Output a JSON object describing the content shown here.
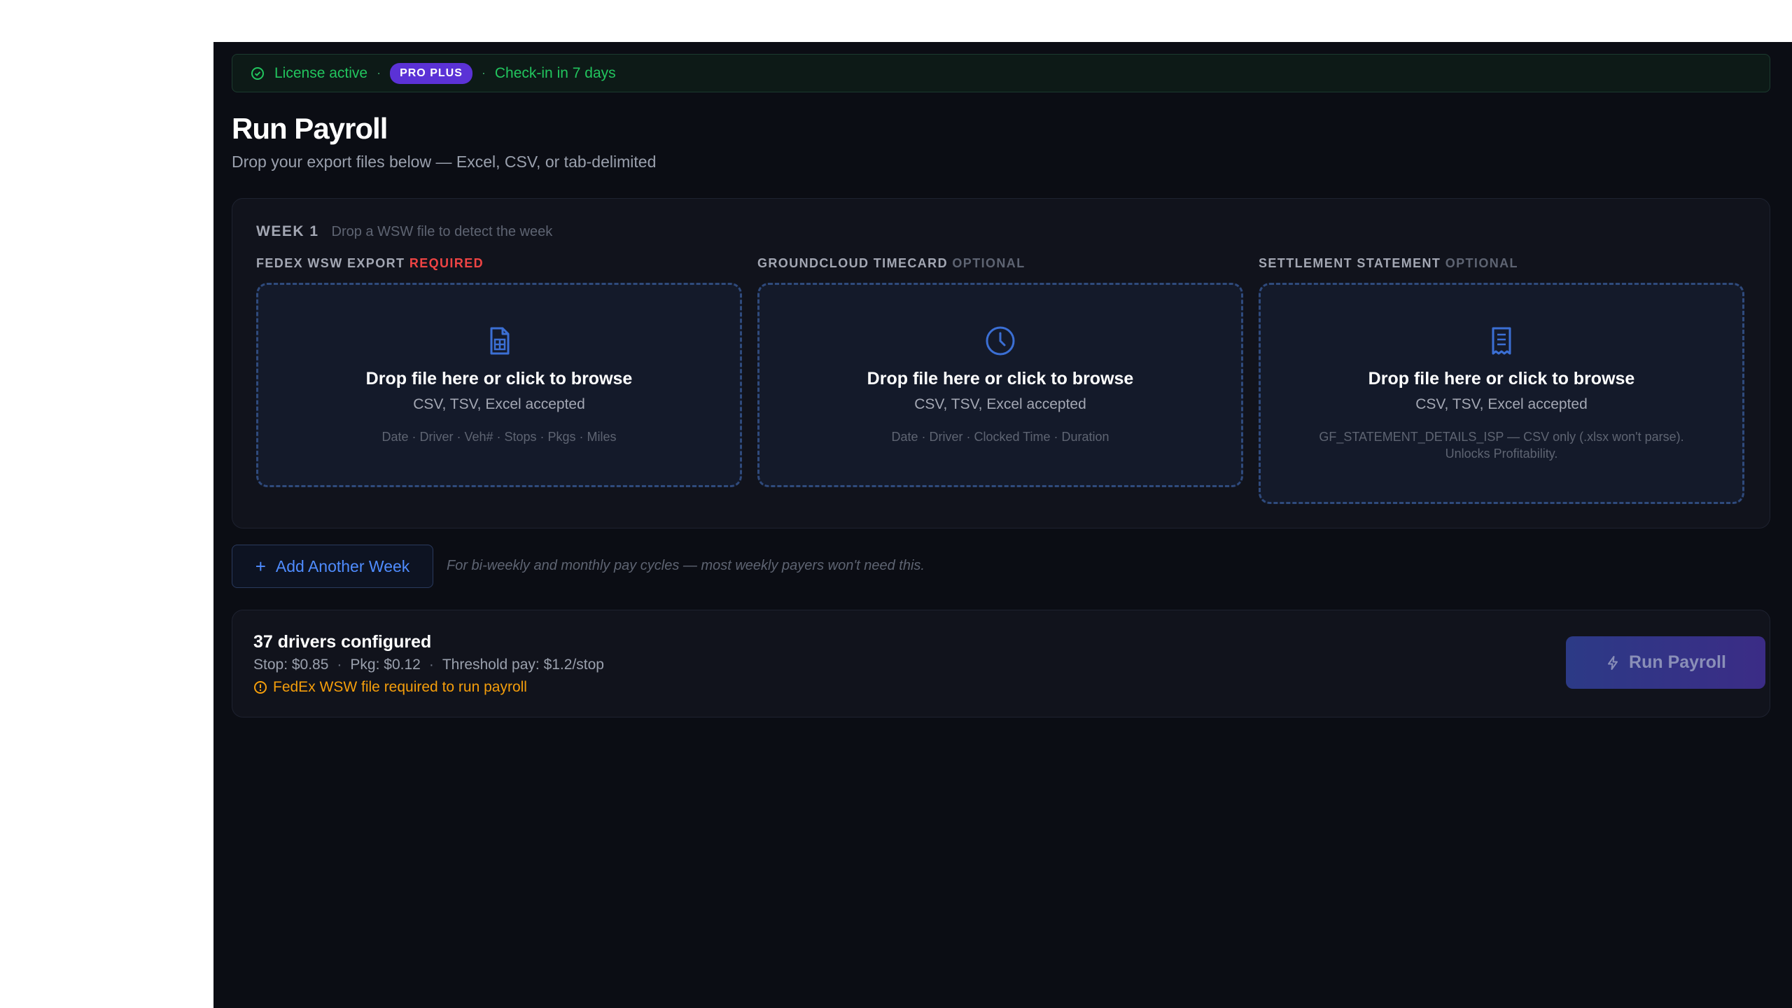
{
  "license": {
    "status": "License active",
    "sep1": "·",
    "plan": "PRO PLUS",
    "sep2": "·",
    "checkin": "Check-in in 7 days"
  },
  "page": {
    "title": "Run Payroll",
    "subtitle": "Drop your export files below — Excel, CSV, or tab-delimited"
  },
  "week": {
    "label": "WEEK 1",
    "hint": "Drop a WSW file to detect the week",
    "columns": [
      {
        "label": "FEDEX WSW EXPORT",
        "tag": "REQUIRED",
        "icon": "spreadsheet-file-icon",
        "title": "Drop file here or click to browse",
        "sub": "CSV, TSV, Excel accepted",
        "fields": "Date · Driver · Veh# · Stops · Pkgs · Miles"
      },
      {
        "label": "GROUNDCLOUD TIMECARD",
        "tag": "OPTIONAL",
        "icon": "clock-icon",
        "title": "Drop file here or click to browse",
        "sub": "CSV, TSV, Excel accepted",
        "fields": "Date · Driver · Clocked Time · Duration"
      },
      {
        "label": "SETTLEMENT STATEMENT",
        "tag": "OPTIONAL",
        "icon": "receipt-icon",
        "title": "Drop file here or click to browse",
        "sub": "CSV, TSV, Excel accepted",
        "fields": "GF_STATEMENT_DETAILS_ISP — CSV only (.xlsx won't parse). Unlocks Profitability."
      }
    ]
  },
  "add_week": {
    "label": "Add Another Week",
    "plus": "+",
    "note": "For bi-weekly and monthly pay cycles — most weekly payers won't need this."
  },
  "summary": {
    "drivers": "37 drivers configured",
    "stop_rate": "Stop: $0.85",
    "pkg_rate": "Pkg: $0.12",
    "threshold": "Threshold pay: $1.2/stop",
    "sep": "·",
    "warning": "FedEx WSW file required to run payroll",
    "run_label": "Run Payroll"
  },
  "colors": {
    "accent_green": "#22c55e",
    "badge_purple": "#5b32d6",
    "required_red": "#ef4444",
    "warning_amber": "#f59e0b",
    "link_blue": "#4f8cff"
  }
}
